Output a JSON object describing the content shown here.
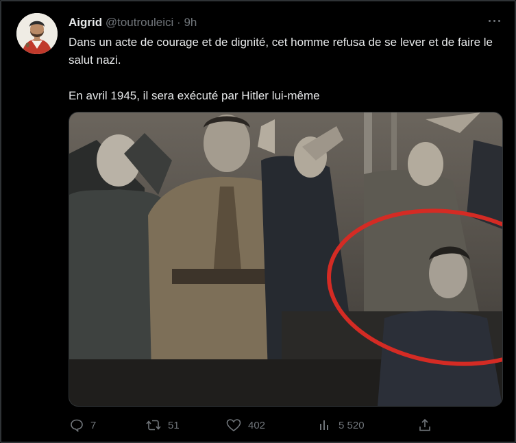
{
  "tweet": {
    "author": {
      "display_name": "Aigrid",
      "handle": "@toutrouleici",
      "separator": "·",
      "time": "9h"
    },
    "text": {
      "paragraph_1": "Dans un acte de courage et de dignité, cet homme refusa de se lever et de faire le salut nazi.",
      "paragraph_2": "En avril 1945, il sera exécuté par Hitler lui-même"
    },
    "media": {
      "highlight_color": "#d42b24"
    },
    "actions": {
      "replies": "7",
      "retweets": "51",
      "likes": "402",
      "views": "5 520"
    }
  },
  "colors": {
    "background": "#000000",
    "text_primary": "#e7e9ea",
    "text_secondary": "#71767b",
    "border": "#2f3336"
  },
  "icons": [
    "more-icon",
    "reply-icon",
    "retweet-icon",
    "like-icon",
    "views-icon",
    "share-icon"
  ]
}
